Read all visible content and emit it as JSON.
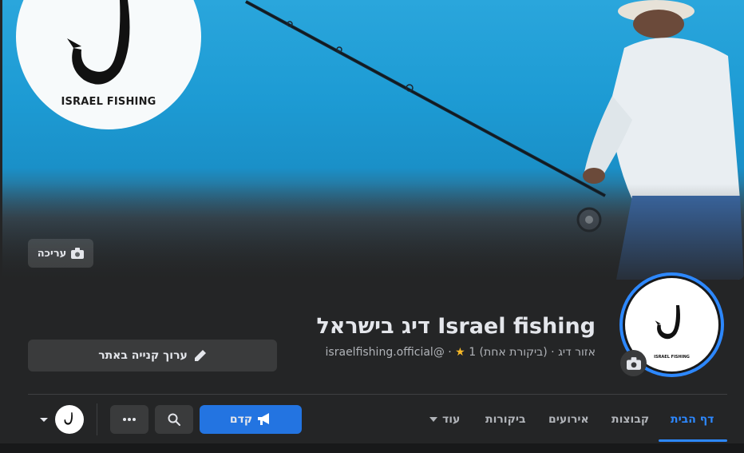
{
  "cover": {
    "logo_text": "ISRAEL FISHING",
    "edit_label": "עריכה",
    "edit_icon": "camera-icon"
  },
  "profile": {
    "name": "Israel fishing דיג בישראל",
    "category": "אזור דיג",
    "rating_text": "(ביקורת אחת) 1",
    "handle": "@israelfishing.official",
    "avatar_text": "ISRAEL FISHING",
    "edit_cta_label": "ערוך קנייה באתר",
    "edit_cta_icon": "pencil-icon"
  },
  "tabs": [
    {
      "label": "דף הבית",
      "active": true
    },
    {
      "label": "קבוצות",
      "active": false
    },
    {
      "label": "אירועים",
      "active": false
    },
    {
      "label": "ביקורות",
      "active": false
    },
    {
      "label": "עוד",
      "active": false
    }
  ],
  "actions": {
    "promote_label": "קדם",
    "promote_icon": "megaphone-icon",
    "search_icon": "search-icon",
    "more_icon": "more-dots-icon"
  },
  "colors": {
    "accent": "#2d88ff",
    "background": "#242526",
    "star": "#f7b928"
  }
}
